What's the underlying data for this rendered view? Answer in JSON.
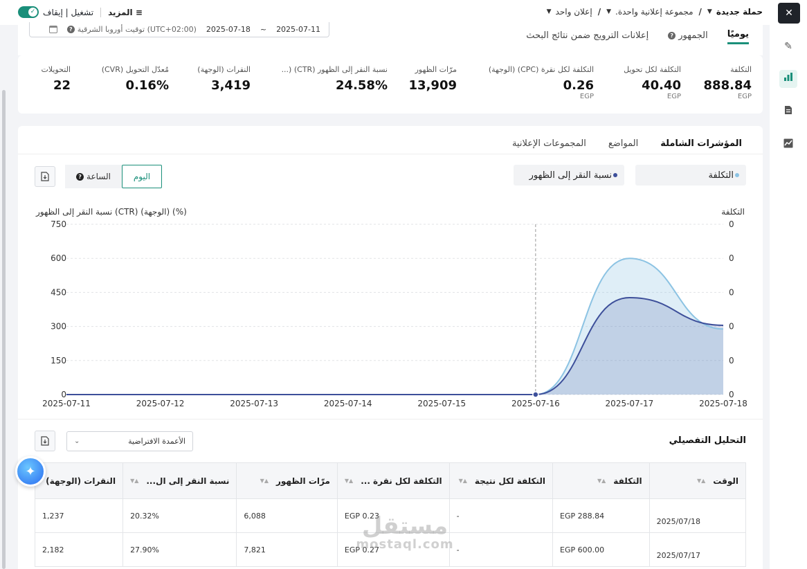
{
  "breadcrumb": {
    "campaign": "حملة جديدة",
    "ad_group": "مجموعة إعلانية واحدة.",
    "ad": "إعلان واحد"
  },
  "topbar": {
    "toggle_label": "تشغيل | إيقاف",
    "more_label": "المزيد"
  },
  "date_range": {
    "start": "2025-07-11",
    "separator": "~",
    "end": "2025-07-18",
    "timezone": "(UTC+02:00) توقيت أوروبا الشرقية"
  },
  "top_tabs": [
    "يوميًا",
    "الجمهور",
    "إعلانات الترويج ضمن نتائج البحث"
  ],
  "metrics": [
    {
      "label": "التكلفة",
      "value": "888.84",
      "unit": "EGP"
    },
    {
      "label": "التكلفة لكل تحويل",
      "value": "40.40",
      "unit": "EGP"
    },
    {
      "label": "التكلفة لكل نقرة (CPC) (الوجهة)",
      "value": "0.26",
      "unit": "EGP"
    },
    {
      "label": "مرّات الظهور",
      "value": "13,909",
      "unit": ""
    },
    {
      "label": "نسبة النقر إلى الظهور (CTR) (...",
      "value": "24.58%",
      "unit": ""
    },
    {
      "label": "النقرات (الوجهة)",
      "value": "3,419",
      "unit": ""
    },
    {
      "label": "مُعدّل التحويل (CVR)",
      "value": "0.16%",
      "unit": ""
    },
    {
      "label": "التحويلات",
      "value": "22",
      "unit": ""
    }
  ],
  "panel_tabs": [
    "المؤشرات الشاملة",
    "المواضع",
    "المجموعات الإعلانية"
  ],
  "chart_controls": {
    "metric1": "التكلفة",
    "metric2": "نسبة النقر إلى الظهور",
    "granularity_day": "اليوم",
    "granularity_hour": "الساعة"
  },
  "colors": {
    "accent": "#1a8f7a",
    "cost_series": "#8cc3e3",
    "ctr_series": "#3d4f9a"
  },
  "chart_data": {
    "type": "area",
    "left_axis_label": "نسبة النقر إلى الظهور (CTR) (الوجهة) (%)",
    "right_axis_label": "التكلفة",
    "left_ticks": [
      "750",
      "600",
      "450",
      "300",
      "150",
      "0"
    ],
    "right_ticks": [
      "0",
      "0",
      "0",
      "0",
      "0",
      "0"
    ],
    "left_ylim": [
      0,
      750
    ],
    "x": [
      "2025-07-11",
      "2025-07-12",
      "2025-07-13",
      "2025-07-14",
      "2025-07-15",
      "2025-07-16",
      "2025-07-17",
      "2025-07-18"
    ],
    "series": [
      {
        "values": [
          0,
          0,
          0,
          0,
          0,
          0,
          600,
          288.84
        ],
        "color": "#8cc3e3"
      },
      {
        "values": [
          0,
          0,
          0,
          0,
          0,
          0,
          427,
          305
        ],
        "color": "#3d4f9a"
      }
    ],
    "grid": true
  },
  "table": {
    "title": "التحليل التفصيلي",
    "columns_selector": "الأعمدة الافتراضية",
    "headers": [
      "الوقت",
      "التكلفة",
      "التكلفة لكل نتيجة",
      "التكلفة لكل نقرة ...",
      "مرّات الظهور",
      "نسبة النقر إلى ال...",
      "النقرات (الوجهة)"
    ],
    "rows": [
      [
        "2025/07/18",
        "EGP 288.84",
        "-",
        "EGP 0.23",
        "6,088",
        "20.32%",
        "1,237"
      ],
      [
        "2025/07/17",
        "EGP 600.00",
        "-",
        "EGP 0.27",
        "7,821",
        "27.90%",
        "2,182"
      ]
    ]
  },
  "watermark": {
    "arabic": "مستقل",
    "latin": "mostaql.com"
  }
}
